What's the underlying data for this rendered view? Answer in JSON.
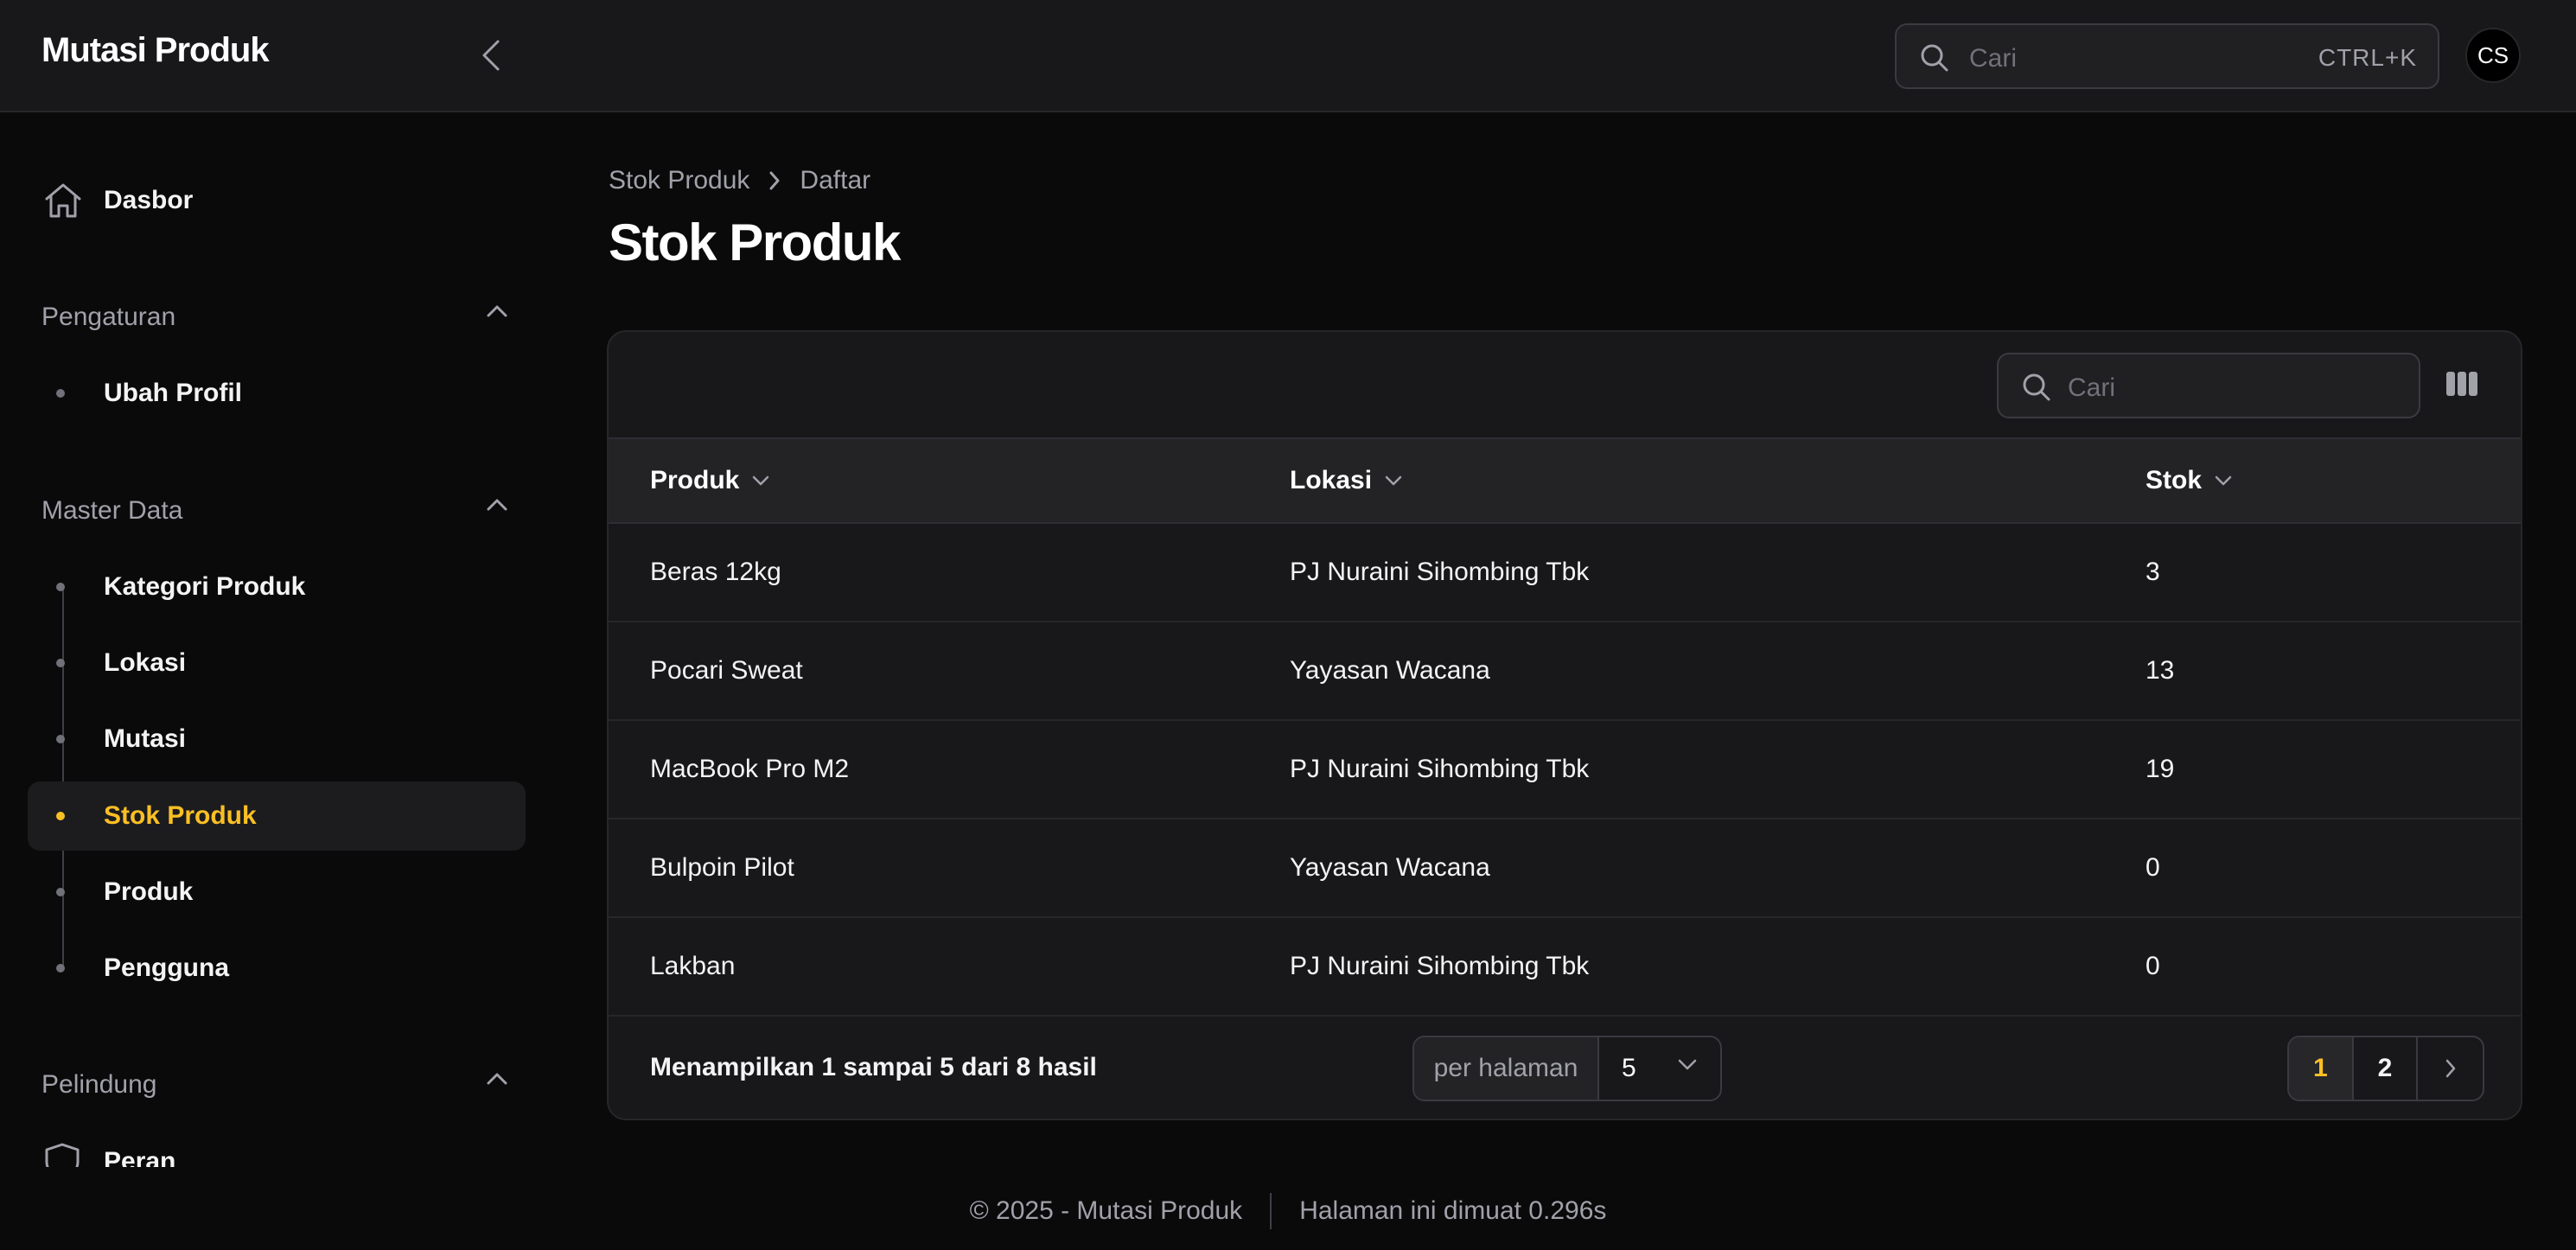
{
  "app": {
    "title": "Mutasi Produk"
  },
  "topbar": {
    "search_placeholder": "Cari",
    "shortcut": "CTRL+K",
    "avatar_initials": "CS"
  },
  "sidebar": {
    "dashboard": {
      "label": "Dasbor",
      "icon": "home-icon"
    },
    "groups": [
      {
        "label": "Pengaturan",
        "items": [
          {
            "label": "Ubah Profil"
          }
        ]
      },
      {
        "label": "Master Data",
        "items": [
          {
            "label": "Kategori Produk"
          },
          {
            "label": "Lokasi"
          },
          {
            "label": "Mutasi"
          },
          {
            "label": "Stok Produk",
            "active": true
          },
          {
            "label": "Produk"
          },
          {
            "label": "Pengguna"
          }
        ]
      },
      {
        "label": "Pelindung",
        "items": [
          {
            "label": "Peran",
            "icon": "shield-icon"
          }
        ]
      }
    ]
  },
  "breadcrumb": {
    "parent": "Stok Produk",
    "current": "Daftar"
  },
  "page": {
    "title": "Stok Produk"
  },
  "table": {
    "search_placeholder": "Cari",
    "columns": [
      "Produk",
      "Lokasi",
      "Stok"
    ],
    "rows": [
      {
        "produk": "Beras 12kg",
        "lokasi": "PJ Nuraini Sihombing Tbk",
        "stok": "3"
      },
      {
        "produk": "Pocari Sweat",
        "lokasi": "Yayasan Wacana",
        "stok": "13"
      },
      {
        "produk": "MacBook Pro M2",
        "lokasi": "PJ Nuraini Sihombing Tbk",
        "stok": "19"
      },
      {
        "produk": "Bulpoin Pilot",
        "lokasi": "Yayasan Wacana",
        "stok": "0"
      },
      {
        "produk": "Lakban",
        "lokasi": "PJ Nuraini Sihombing Tbk",
        "stok": "0"
      }
    ],
    "summary": "Menampilkan 1 sampai 5 dari 8 hasil",
    "per_page_label": "per halaman",
    "per_page_value": "5",
    "pages": [
      "1",
      "2"
    ],
    "current_page": "1"
  },
  "footer": {
    "copyright": "© 2025 - Mutasi Produk",
    "load_time": "Halaman ini dimuat 0.296s"
  },
  "colors": {
    "accent": "#fbbf24",
    "background": "#0a0a0b",
    "surface": "#18181b"
  }
}
